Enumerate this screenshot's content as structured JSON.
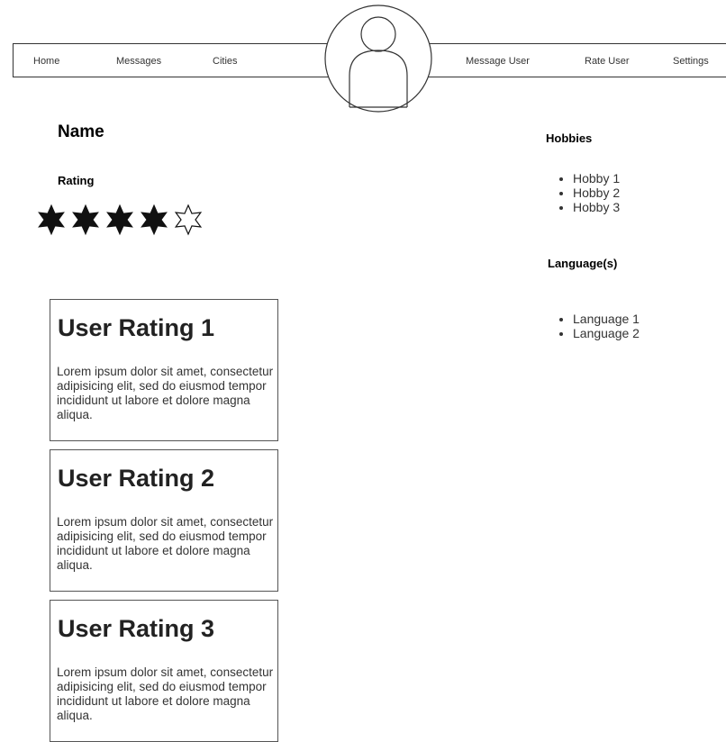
{
  "nav": {
    "left": [
      "Home",
      "Messages",
      "Cities"
    ],
    "right": [
      "Message User",
      "Rate User",
      "Settings"
    ]
  },
  "profile": {
    "avatar_icon": "user-avatar-icon",
    "name": "Name",
    "rating_label": "Rating",
    "rating_value": 4,
    "rating_max": 5,
    "star_icons": [
      "filled-star-icon",
      "empty-star-icon"
    ]
  },
  "hobbies": {
    "heading": "Hobbies",
    "items": [
      "Hobby 1",
      "Hobby 2",
      "Hobby 3"
    ]
  },
  "languages": {
    "heading": "Language(s)",
    "items": [
      "Language 1",
      "Language 2"
    ]
  },
  "user_ratings": [
    {
      "title": "User Rating 1",
      "body": "Lorem ipsum dolor sit amet, consectetur adipisicing elit, sed do eiusmod tempor incididunt ut labore et dolore magna aliqua."
    },
    {
      "title": "User Rating 2",
      "body": "Lorem ipsum dolor sit amet, consectetur adipisicing elit, sed do eiusmod tempor incididunt ut labore et dolore magna aliqua."
    },
    {
      "title": "User Rating 3",
      "body": "Lorem ipsum dolor sit amet, consectetur adipisicing elit, sed do eiusmod tempor incididunt ut labore et dolore magna aliqua."
    }
  ]
}
